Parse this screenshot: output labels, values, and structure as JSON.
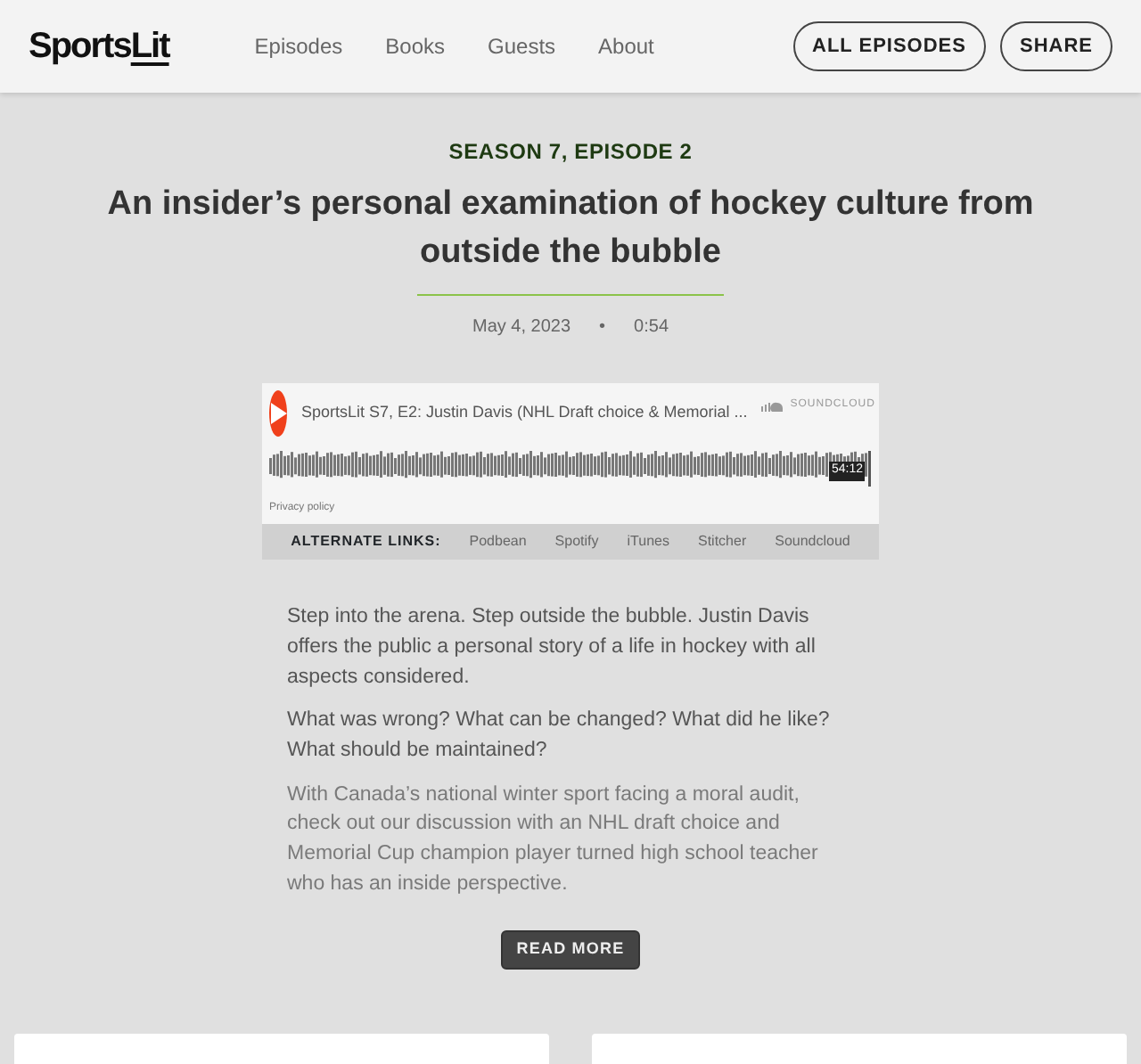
{
  "logo": {
    "text": "Sports",
    "accent": "Lit"
  },
  "nav": [
    {
      "label": "Episodes"
    },
    {
      "label": "Books"
    },
    {
      "label": "Guests"
    },
    {
      "label": "About"
    }
  ],
  "header_buttons": [
    "ALL EPISODES",
    "SHARE"
  ],
  "episode": {
    "kicker": "SEASON 7, EPISODE 2",
    "title": "An insider’s personal examination of hockey culture from outside the bubble",
    "date": "May 4, 2023",
    "separator": "•",
    "duration": "0:54"
  },
  "player": {
    "title": "SportsLit S7, E2: Justin Davis (NHL Draft choice & Memorial ...",
    "brand": "SOUNDCLOUD",
    "time": "54:12",
    "privacy": "Privacy policy"
  },
  "alternate_links": {
    "label": "ALTERNATE LINKS:",
    "links": [
      "Podbean",
      "Spotify",
      "iTunes",
      "Stitcher",
      "Soundcloud"
    ]
  },
  "paragraphs": [
    "Step into the arena. Step outside the bubble. Justin Davis offers the public a personal story of a life in hockey with all aspects considered.",
    "What was wrong? What can be changed? What did he like? What should be maintained?",
    "With Canada’s national winter sport facing a moral audit, check out our discussion with an NHL draft choice and Memorial Cup champion player turned high school teacher who has an inside perspective."
  ],
  "read_more": "READ MORE"
}
